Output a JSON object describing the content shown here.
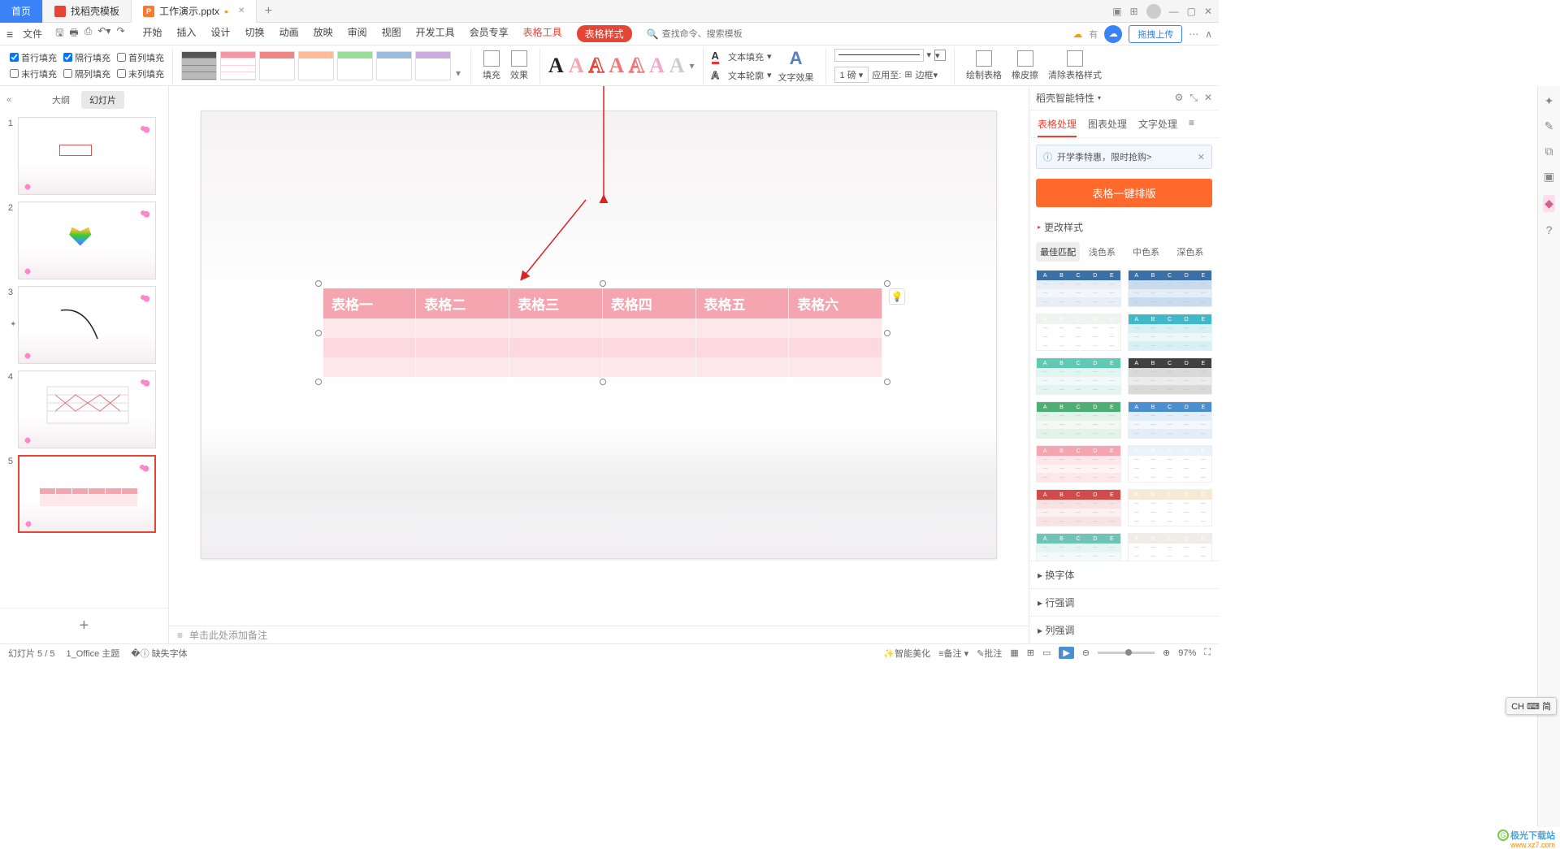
{
  "tabs": {
    "home": "首页",
    "template": "找稻壳模板",
    "doc": "工作演示.pptx"
  },
  "menu": {
    "file": "文件"
  },
  "ribbon_tabs": [
    "开始",
    "插入",
    "设计",
    "切换",
    "动画",
    "放映",
    "审阅",
    "视图",
    "开发工具",
    "会员专享"
  ],
  "tool_tab": "表格工具",
  "style_tab": "表格样式",
  "search_placeholder": "查找命令、搜索模板",
  "cloud_hint": "有",
  "upload_btn": "拖拽上传",
  "checks": {
    "first_row": "首行填充",
    "alt_row": "隔行填充",
    "first_col": "首列填充",
    "last_row": "末行填充",
    "alt_col": "隔列填充",
    "last_col": "末列填充"
  },
  "groups": {
    "fill": "填充",
    "effect": "效果",
    "text_fill": "文本填充",
    "text_outline": "文本轮廓",
    "text_effect": "文字效果",
    "weight": "1 磅",
    "apply_to": "应用至:",
    "border": "边框",
    "draw_table": "绘制表格",
    "eraser": "橡皮擦",
    "clear_style": "清除表格样式"
  },
  "side_tabs": {
    "outline": "大纲",
    "slides": "幻灯片"
  },
  "slide_numbers": [
    "1",
    "2",
    "3",
    "4",
    "5"
  ],
  "table_headers": [
    "表格一",
    "表格二",
    "表格三",
    "表格四",
    "表格五",
    "表格六"
  ],
  "notes_placeholder": "单击此处添加备注",
  "right_panel": {
    "title": "稻壳智能特性",
    "tabs": [
      "表格处理",
      "图表处理",
      "文字处理"
    ],
    "promo": "开学季特惠，限时抢购>",
    "big_btn": "表格一键排版",
    "change_style": "更改样式",
    "style_tabs": [
      "最佳匹配",
      "浅色系",
      "中色系",
      "深色系"
    ],
    "accordion": [
      "换字体",
      "行强调",
      "列强调"
    ]
  },
  "status": {
    "slide_pos": "幻灯片 5 / 5",
    "theme": "1_Office 主题",
    "missing_font": "缺失字体",
    "beautify": "智能美化",
    "notes": "备注",
    "review": "批注",
    "zoom": "97%"
  },
  "ime": "CH ⌨ 简",
  "watermark": "极光下载站",
  "watermark_url": "www.xz7.com",
  "style_colors": [
    [
      "#3b6fa8",
      "#e8eef5"
    ],
    [
      "#3b6fa8",
      "#c8dced"
    ],
    [
      "#eef4f0",
      "#ffffff"
    ],
    [
      "#3fb8c9",
      "#d6f0f3"
    ],
    [
      "#5fc9b3",
      "#e3f5f1"
    ],
    [
      "#404040",
      "#d9d9d9"
    ],
    [
      "#4eaf75",
      "#e4f3ea"
    ],
    [
      "#4a8fcf",
      "#e3eef8"
    ],
    [
      "#f5a5b0",
      "#fce7ea"
    ],
    [
      "#eaf3fb",
      "#ffffff"
    ],
    [
      "#d24a4a",
      "#f7e3e3"
    ],
    [
      "#f7e9d3",
      "#ffffff"
    ],
    [
      "#6fc4b5",
      "#e7f5f2"
    ],
    [
      "#f0ede6",
      "#ffffff"
    ]
  ]
}
